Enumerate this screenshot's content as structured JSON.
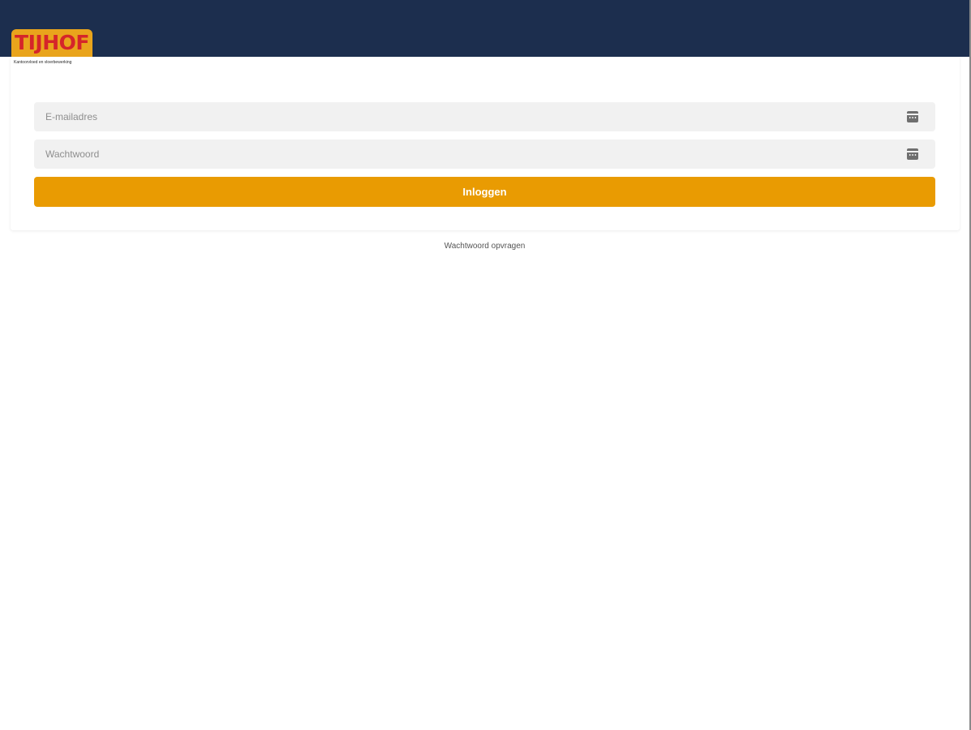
{
  "brand": {
    "logo_text": "TIJHOF",
    "tagline": "Kantoorvloed en vloerbewerking",
    "colors": {
      "header_bg": "#1c2e4e",
      "logo_badge": "#e9a41c",
      "logo_text": "#d5252a",
      "accent": "#e99b02"
    }
  },
  "login_form": {
    "email": {
      "placeholder": "E-mailadres",
      "value": "",
      "icon": "autofill-card-icon"
    },
    "password": {
      "placeholder": "Wachtwoord",
      "value": "",
      "icon": "autofill-card-icon"
    },
    "submit_label": "Inloggen"
  },
  "links": {
    "forgot_password": "Wachtwoord opvragen"
  }
}
